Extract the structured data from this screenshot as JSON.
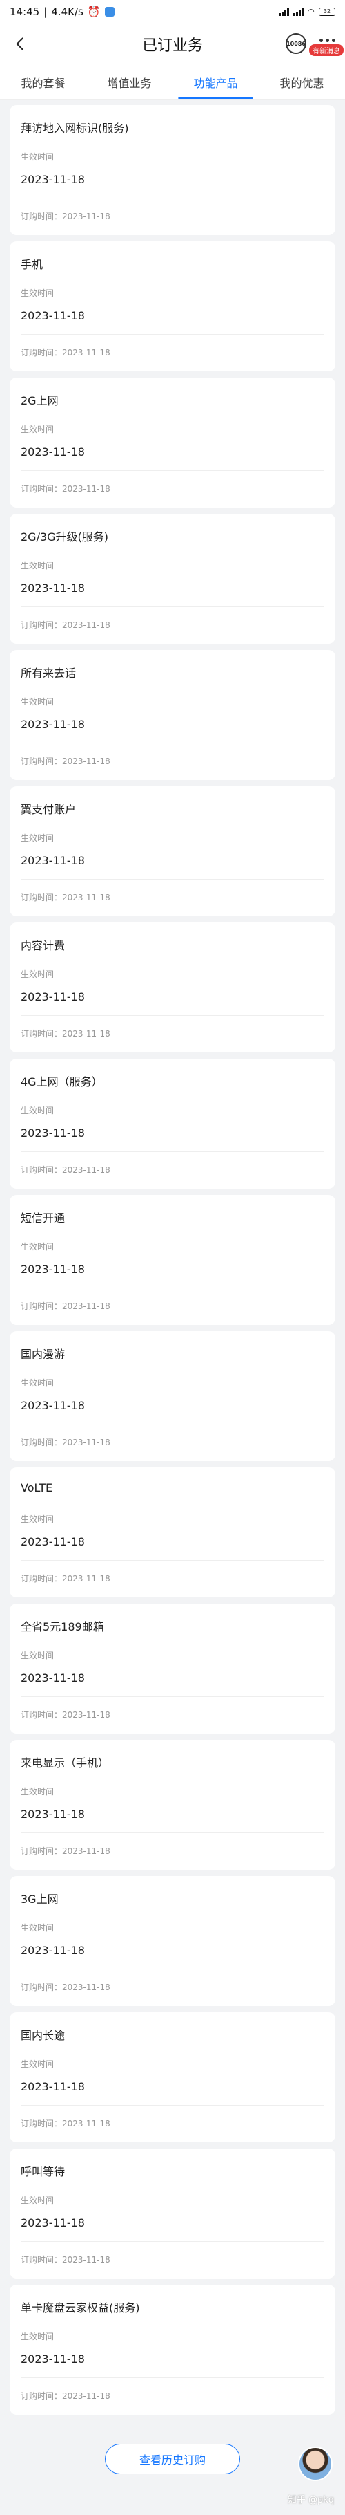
{
  "status_bar": {
    "time": "14:45",
    "speed": "4.4K/s",
    "battery": "32"
  },
  "nav": {
    "title": "已订业务",
    "msg_icon_text": "10086",
    "msg_badge": "有新消息"
  },
  "tabs": [
    {
      "label": "我的套餐"
    },
    {
      "label": "增值业务"
    },
    {
      "label": "功能产品"
    },
    {
      "label": "我的优惠"
    }
  ],
  "active_tab": "功能产品",
  "cards": [
    {
      "name": "拜访地入网标识(服务)",
      "effective_label": "生效时间",
      "effective_date": "2023-11-18",
      "order_label": "订购时间：2023-11-18"
    },
    {
      "name": "手机",
      "effective_label": "生效时间",
      "effective_date": "2023-11-18",
      "order_label": "订购时间：2023-11-18"
    },
    {
      "name": "2G上网",
      "effective_label": "生效时间",
      "effective_date": "2023-11-18",
      "order_label": "订购时间：2023-11-18"
    },
    {
      "name": "2G/3G升级(服务)",
      "effective_label": "生效时间",
      "effective_date": "2023-11-18",
      "order_label": "订购时间：2023-11-18"
    },
    {
      "name": "所有来去话",
      "effective_label": "生效时间",
      "effective_date": "2023-11-18",
      "order_label": "订购时间：2023-11-18"
    },
    {
      "name": "翼支付账户",
      "effective_label": "生效时间",
      "effective_date": "2023-11-18",
      "order_label": "订购时间：2023-11-18"
    },
    {
      "name": "内容计费",
      "effective_label": "生效时间",
      "effective_date": "2023-11-18",
      "order_label": "订购时间：2023-11-18"
    },
    {
      "name": "4G上网（服务）",
      "effective_label": "生效时间",
      "effective_date": "2023-11-18",
      "order_label": "订购时间：2023-11-18"
    },
    {
      "name": "短信开通",
      "effective_label": "生效时间",
      "effective_date": "2023-11-18",
      "order_label": "订购时间：2023-11-18"
    },
    {
      "name": "国内漫游",
      "effective_label": "生效时间",
      "effective_date": "2023-11-18",
      "order_label": "订购时间：2023-11-18"
    },
    {
      "name": "VoLTE",
      "effective_label": "生效时间",
      "effective_date": "2023-11-18",
      "order_label": "订购时间：2023-11-18"
    },
    {
      "name": "全省5元189邮箱",
      "effective_label": "生效时间",
      "effective_date": "2023-11-18",
      "order_label": "订购时间：2023-11-18"
    },
    {
      "name": "来电显示（手机）",
      "effective_label": "生效时间",
      "effective_date": "2023-11-18",
      "order_label": "订购时间：2023-11-18"
    },
    {
      "name": "3G上网",
      "effective_label": "生效时间",
      "effective_date": "2023-11-18",
      "order_label": "订购时间：2023-11-18"
    },
    {
      "name": "国内长途",
      "effective_label": "生效时间",
      "effective_date": "2023-11-18",
      "order_label": "订购时间：2023-11-18"
    },
    {
      "name": "呼叫等待",
      "effective_label": "生效时间",
      "effective_date": "2023-11-18",
      "order_label": "订购时间：2023-11-18"
    },
    {
      "name": "单卡魔盘云家权益(服务)",
      "effective_label": "生效时间",
      "effective_date": "2023-11-18",
      "order_label": "订购时间：2023-11-18"
    }
  ],
  "footer": {
    "history_button": "查看历史订购",
    "watermark": "知乎 @pkq"
  },
  "colors": {
    "accent": "#1677ff",
    "background": "#f2f3f5",
    "badge": "#e63a3a"
  }
}
